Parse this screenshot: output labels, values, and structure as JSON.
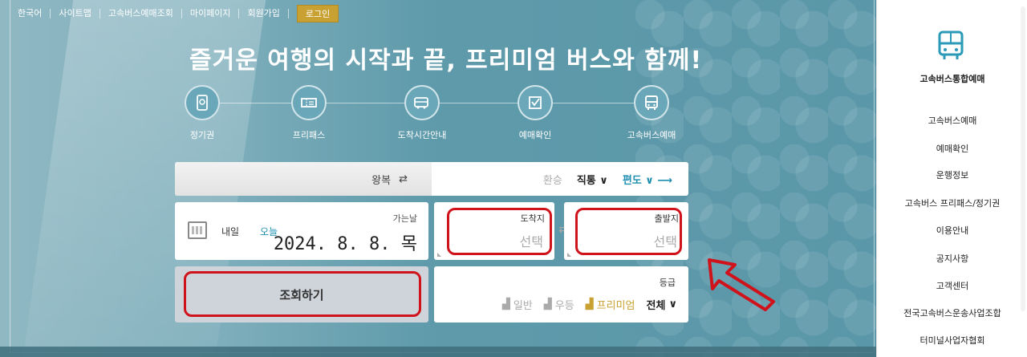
{
  "topnav": {
    "items": [
      "한국어",
      "사이트맵",
      "고속버스예매조회",
      "마이페이지",
      "회원가입"
    ],
    "login": "로그인"
  },
  "headline": "즐거운 여행의 시작과 끝, 프리미엄 버스와 함께!",
  "menus": [
    {
      "label": "고속버스예매",
      "icon": "bus-icon"
    },
    {
      "label": "예매확인",
      "icon": "check-box-icon"
    },
    {
      "label": "도착시간안내",
      "icon": "bus-clock-icon"
    },
    {
      "label": "프리패스",
      "icon": "ticket-icon"
    },
    {
      "label": "정기권",
      "icon": "pass-card-icon"
    }
  ],
  "trip": {
    "roundtrip_label": "왕복",
    "oneway_label": "편도",
    "direct_label": "직통",
    "transfer_label": "환승"
  },
  "date": {
    "label": "가는날",
    "value": "2024. 8. 8. 목",
    "today": "오늘",
    "tomorrow": "내일"
  },
  "departure": {
    "label": "출발지",
    "placeholder": "선택"
  },
  "arrival": {
    "label": "도착지",
    "placeholder": "선택"
  },
  "grade": {
    "label": "등급",
    "options": [
      "전체",
      "프리미엄",
      "우등",
      "일반"
    ]
  },
  "search_button": "조회하기",
  "sidebar": {
    "title": "고속버스통합예매",
    "items": [
      "고속버스예매",
      "예매확인",
      "운행정보",
      "고속버스 프리패스/정기권",
      "이용안내",
      "공지사항",
      "고객센터",
      "전국고속버스운송사업조합",
      "터미널사업자협회"
    ]
  },
  "colors": {
    "accent": "#1e8fb0",
    "highlight": "#d0121b",
    "gold": "#c9a032"
  }
}
